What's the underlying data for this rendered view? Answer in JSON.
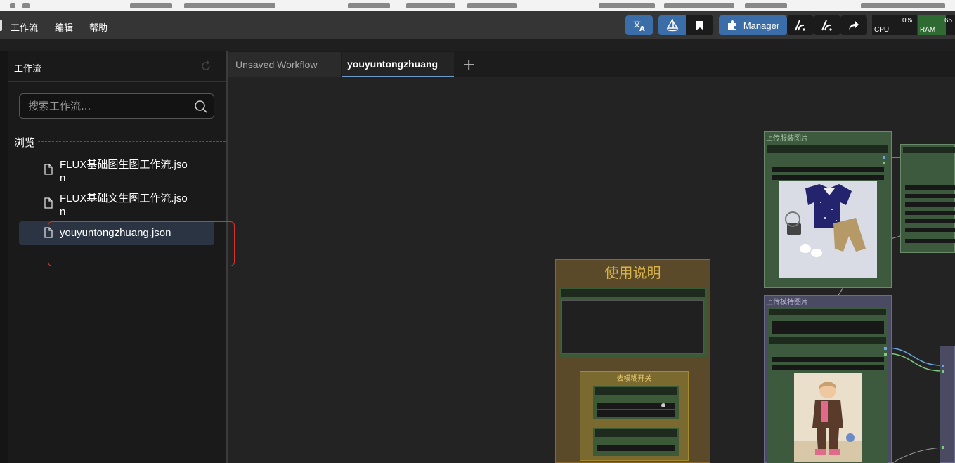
{
  "menubar": {
    "items": [
      "工作流",
      "编辑",
      "帮助"
    ]
  },
  "toolbar": {
    "manager_label": "Manager",
    "cpu_label": "CPU",
    "cpu_value": "0%",
    "ram_label": "RAM",
    "ram_value": "65"
  },
  "sidebar": {
    "title": "工作流",
    "search_placeholder": "搜索工作流...",
    "browse_label": "浏览",
    "items": [
      {
        "label": "FLUX基础图生图工作流.json",
        "selected": false
      },
      {
        "label": "FLUX基础文生图工作流.json",
        "selected": false
      },
      {
        "label": "youyuntongzhuang.json",
        "selected": true
      }
    ]
  },
  "tabs": [
    {
      "label": "Unsaved Workflow",
      "active": false
    },
    {
      "label": "youyuntongzhuang",
      "active": true
    }
  ],
  "add_tab_label": "+",
  "canvas": {
    "nodes": {
      "instructions": {
        "title": "使用说明",
        "color": "#5a4a2a"
      },
      "upload_clothing": {
        "title": "上传服装图片",
        "color": "#3e5a3e"
      },
      "upload_model": {
        "title": "上传模特图片",
        "color": "#4a4a62"
      },
      "deblur_switch": {
        "title": "去模糊开关"
      }
    }
  }
}
